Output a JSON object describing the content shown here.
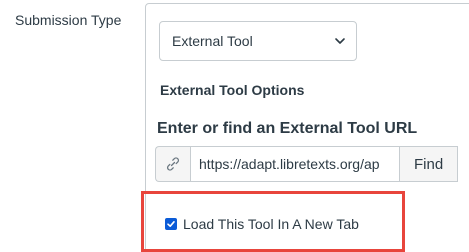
{
  "submission": {
    "label": "Submission Type",
    "selected_type": "External Tool",
    "options_heading": "External Tool Options",
    "url_heading": "Enter or find an External Tool URL",
    "url_value": "https://adapt.libretexts.org/ap",
    "find_label": "Find",
    "new_tab_checkbox_label": "Load This Tool In A New Tab",
    "new_tab_checked": true
  },
  "colors": {
    "highlight": "#e8453c",
    "checkbox": "#0b5bd7"
  },
  "icons": {
    "select": "chevron-down-icon",
    "url_prefix": "link-icon",
    "checkbox": "checkmark-icon"
  }
}
